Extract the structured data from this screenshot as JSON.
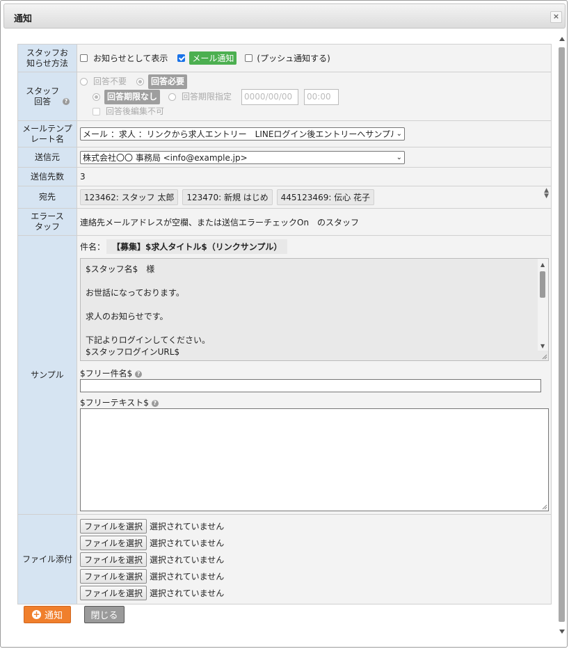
{
  "dialog": {
    "title": "通知",
    "close_label": "×"
  },
  "rows": {
    "staff_notice_method": {
      "label": "スタッフお知らせ方法",
      "show_as_notice": "お知らせとして表示",
      "mail_notify": "メール通知",
      "push_notify": "(プッシュ通知する)"
    },
    "staff_reply": {
      "label": "スタッフ回答",
      "no_reply": "回答不要",
      "reply_required": "回答必要",
      "no_deadline": "回答期限なし",
      "deadline_specified": "回答期限指定",
      "date_placeholder": "0000/00/00",
      "time_placeholder": "00:00",
      "no_edit_after": "回答後編集不可"
    },
    "mail_template": {
      "label": "メールテンプレート名",
      "value": "メール ：求人 ：リンクから求人エントリー　LINEログイン後エントリーへサンプル"
    },
    "sender": {
      "label": "送信元",
      "value": "株式会社〇〇 事務局 <info@example.jp>"
    },
    "send_count": {
      "label": "送信先数",
      "value": "3"
    },
    "recipients": {
      "label": "宛先",
      "items": [
        "123462: スタッフ 太郎",
        "123470: 新規 はじめ",
        "445123469: 伝心 花子"
      ]
    },
    "error_staff": {
      "label": "エラースタッフ",
      "value": "連絡先メールアドレスが空欄、または送信エラーチェックOn　のスタッフ"
    },
    "sample": {
      "label": "サンプル",
      "subject_label": "件名：",
      "subject_value": "【募集】$求人タイトル$（リンクサンプル）",
      "body_lines": [
        "$スタッフ名$　様",
        "",
        "お世話になっております。",
        "",
        "求人のお知らせです。",
        "",
        "下記よりログインしてください。",
        "$スタッフログインURL$"
      ],
      "free_subject_label": "$フリー件名$",
      "free_text_label": "$フリーテキスト$"
    },
    "attachment": {
      "label": "ファイル添付",
      "button_label": "ファイルを選択",
      "status": "選択されていません"
    }
  },
  "footer": {
    "notify_label": "通知",
    "close_label": "閉じる"
  }
}
